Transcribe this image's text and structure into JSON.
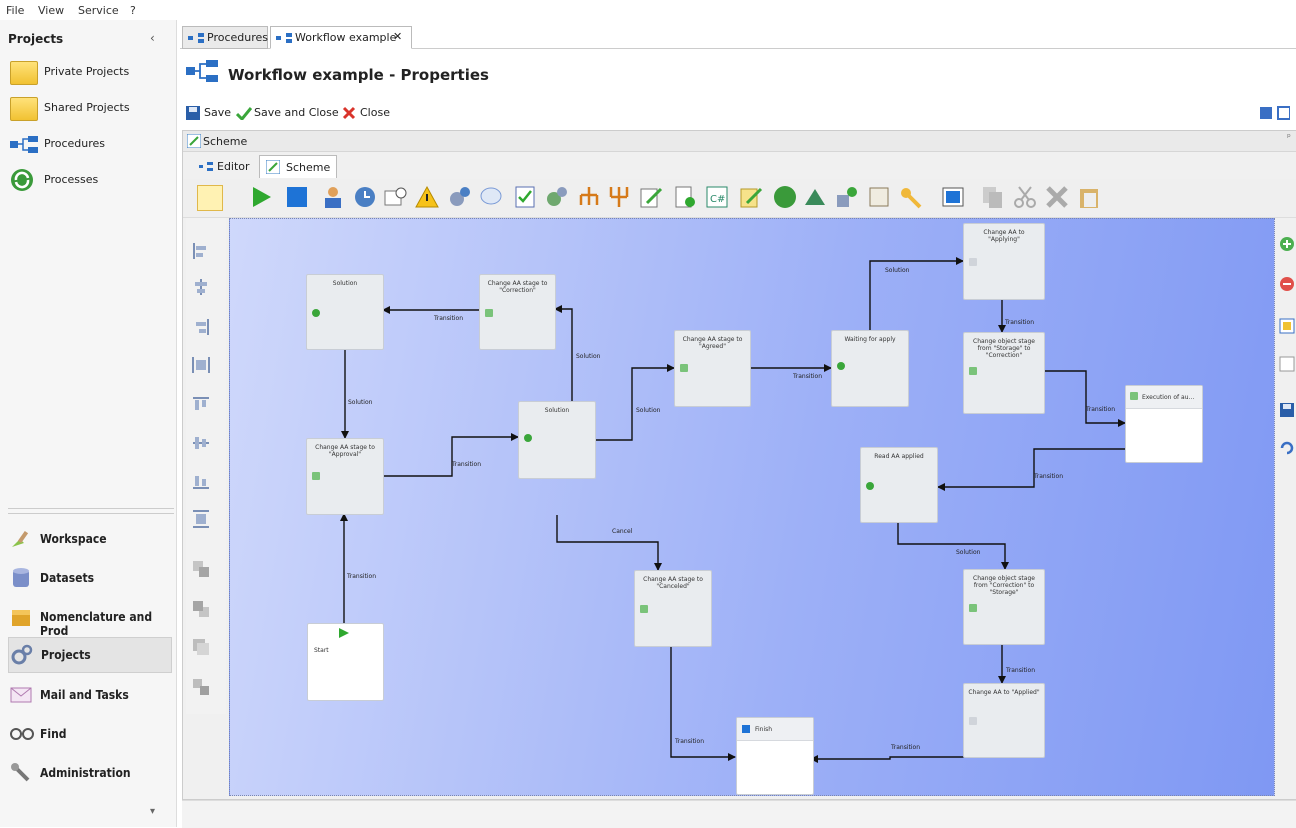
{
  "menu": {
    "file": "File",
    "view": "View",
    "service": "Service",
    "help": "?"
  },
  "sidebar": {
    "title": "Projects",
    "collapse": "‹",
    "tree": [
      {
        "label": "Private Projects"
      },
      {
        "label": "Shared Projects"
      },
      {
        "label": "Procedures"
      },
      {
        "label": "Processes"
      }
    ],
    "nav": [
      {
        "label": "Workspace"
      },
      {
        "label": "Datasets"
      },
      {
        "label": "Nomenclature and Prod"
      },
      {
        "label": "Projects"
      },
      {
        "label": "Mail and Tasks"
      },
      {
        "label": "Find"
      },
      {
        "label": "Administration"
      }
    ],
    "scroll_down": "▾"
  },
  "tabs": {
    "procedures": "Procedures",
    "workflow": "Workflow example",
    "close": "✕"
  },
  "header": {
    "title": "Workflow example - Properties"
  },
  "toolbar": {
    "save": "Save",
    "save_close": "Save and Close",
    "close": "Close"
  },
  "scheme": {
    "panel_title": "Scheme",
    "pin": "ᵖ",
    "subtab_editor": "Editor",
    "subtab_scheme": "Scheme"
  },
  "nodes": {
    "n_solution1": "Solution",
    "n_correction": "Change AA stage to \"Correction\"",
    "n_agreed": "Change AA stage to \"Agreed\"",
    "n_waiting": "Waiting for apply",
    "n_applying": "Change AA to \"Applying\"",
    "n_storage_corr": "Change object stage from \"Storage\" to \"Correction\"",
    "n_execution": "Execution of au...",
    "n_approval": "Change AA stage to \"Approval\"",
    "n_solution2": "Solution",
    "n_read": "Read AA applied",
    "n_canceled": "Change AA stage to \"Canceled\"",
    "n_corr_storage": "Change object stage from \"Correction\" to \"Storage\"",
    "n_start": "Start",
    "n_finish": "Finish",
    "n_applied": "Change AA to \"Applied\""
  },
  "edge_labels": {
    "e1": "Transition",
    "e2": "Solution",
    "e3": "Solution",
    "e4": "Transition",
    "e5": "Solution",
    "e6": "Transition",
    "e7": "Solution",
    "e8": "Transition",
    "e9": "Transition",
    "e10": "Transition",
    "e11": "Solution",
    "e12": "Cancel",
    "e13": "Transition",
    "e14": "Transition",
    "e15": "Transition",
    "e16": "Transition"
  }
}
